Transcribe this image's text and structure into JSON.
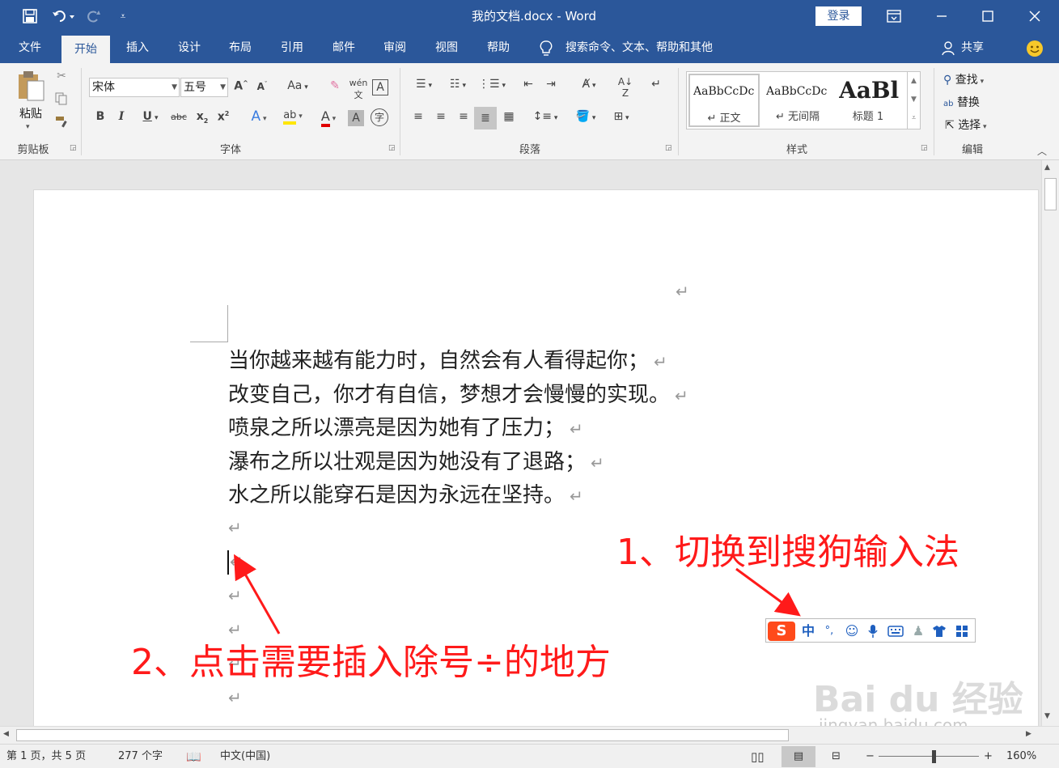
{
  "titlebar": {
    "save_icon": "save-icon",
    "undo_icon": "undo-icon",
    "redo_icon": "redo-icon",
    "customize_icon": "customize-qat-icon",
    "title": "我的文档.docx  -  Word",
    "login_label": "登录",
    "ribbon_display_icon": "ribbon-display-options-icon",
    "minimize_icon": "minimize-icon",
    "maximize_icon": "maximize-icon",
    "close_icon": "close-icon"
  },
  "tabs": [
    "文件",
    "开始",
    "插入",
    "设计",
    "布局",
    "引用",
    "邮件",
    "审阅",
    "视图",
    "帮助"
  ],
  "active_tab": "开始",
  "search_label": "搜索命令、文本、帮助和其他",
  "share_label": "共享",
  "ribbon": {
    "clipboard": {
      "paste_label": "粘贴",
      "group_label": "剪贴板"
    },
    "font": {
      "font_name": "宋体",
      "font_size": "五号",
      "aa_label": "Aa",
      "group_label": "字体"
    },
    "paragraph": {
      "group_label": "段落"
    },
    "styles": {
      "preview1": "AaBbCcDc",
      "preview2": "AaBbCcDc",
      "preview3": "AaBl",
      "items": [
        "↵ 正文",
        "↵ 无间隔",
        "标题 1"
      ],
      "group_label": "样式"
    },
    "editing": {
      "find_label": "查找",
      "replace_label": "替换",
      "select_label": "选择",
      "group_label": "编辑"
    }
  },
  "document": {
    "lines": [
      "当你越来越有能力时，自然会有人看得起你；",
      "改变自己，你才有自信，梦想才会慢慢的实现。",
      "喷泉之所以漂亮是因为她有了压力；",
      "瀑布之所以壮观是因为她没有了退路；",
      "水之所以能穿石是因为永远在坚持。"
    ],
    "paragraph_mark": "↵"
  },
  "annotations": {
    "step1": "1、切换到搜狗输入法",
    "step2": "2、点击需要插入除号÷的地方"
  },
  "ime_toolbar": {
    "logo": "S",
    "mode": "中",
    "punct": "°,"
  },
  "watermark": {
    "brand": "Bai du 经验",
    "url": "jingyan.baidu.com"
  },
  "statusbar": {
    "page_info": "第 1 页，共 5 页",
    "word_count": "277 个字",
    "language": "中文(中国)",
    "zoom": "160%"
  },
  "colors": {
    "accent": "#2b579a",
    "annotation": "#ff1a1a"
  }
}
